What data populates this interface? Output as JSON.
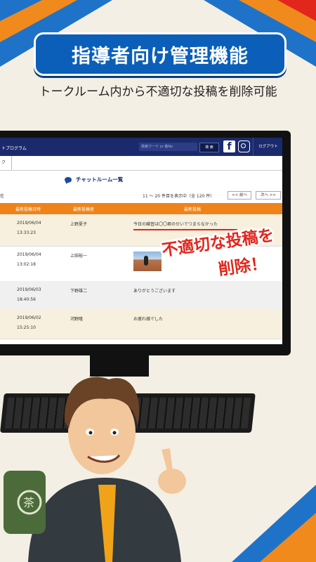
{
  "headline": "指導者向け管理機能",
  "subline": "トークルーム内から不適切な投稿を削除可能",
  "app": {
    "program_label": "トプログラム",
    "search_placeholder": "検索ワード or 番No",
    "search_button": "検 索",
    "logout": "ログアウト",
    "subnav_tab": "ク",
    "page_title": "チャットルーム一覧",
    "status_left": "在",
    "result_count": "11 〜 20 件目を表示中（全 120 件）",
    "prev": "<< 前へ",
    "next": "次へ >>",
    "columns": [
      "最新投稿日時",
      "最新投稿者",
      "最新投稿"
    ],
    "rows": [
      {
        "date": "2019/06/04",
        "time": "13:33:23",
        "poster": "上野夏子",
        "message": "今日の練習は〇〇君のせいでつまらなかった"
      },
      {
        "date": "2019/06/04",
        "time": "13:02:18",
        "poster": "上田裕一",
        "message": ""
      },
      {
        "date": "2019/06/03",
        "time": "18:40:56",
        "poster": "下野雄二",
        "message": "ありがとうございます"
      },
      {
        "date": "2019/06/02",
        "time": "15:25:10",
        "poster": "河野隆",
        "message": "お疲れ様でした"
      }
    ]
  },
  "callout": {
    "line1": "不適切な投稿を",
    "line2": "削除！"
  },
  "colors": {
    "accent_blue": "#0b5fb8",
    "header_orange": "#ee8419",
    "alert_red": "#e1261c",
    "nav_navy": "#1a2a6c"
  }
}
